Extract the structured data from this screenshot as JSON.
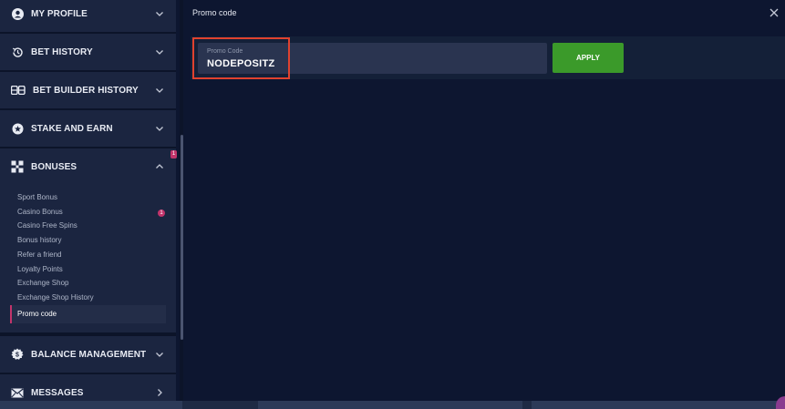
{
  "sidebar": {
    "items": [
      {
        "label": "MY PROFILE",
        "icon": "user-icon"
      },
      {
        "label": "BET HISTORY",
        "icon": "history-icon"
      },
      {
        "label": "BET BUILDER HISTORY",
        "icon": "bet-builder-icon"
      },
      {
        "label": "STAKE AND EARN",
        "icon": "stake-icon"
      },
      {
        "label": "BONUSES",
        "icon": "gift-icon",
        "badge": "1"
      },
      {
        "label": "BALANCE MANAGEMENT",
        "icon": "balance-icon"
      },
      {
        "label": "MESSAGES",
        "icon": "envelope-icon"
      }
    ],
    "bonuses_submenu": [
      {
        "label": "Sport Bonus"
      },
      {
        "label": "Casino Bonus",
        "badge": "1"
      },
      {
        "label": "Casino Free Spins"
      },
      {
        "label": "Bonus history"
      },
      {
        "label": "Refer a friend"
      },
      {
        "label": "Loyalty Points"
      },
      {
        "label": "Exchange Shop"
      },
      {
        "label": "Exchange Shop History"
      },
      {
        "label": "Promo code",
        "active": true
      }
    ]
  },
  "header": {
    "title": "Promo code"
  },
  "promo": {
    "field_label": "Promo Code",
    "value": "NODEPOSITZ",
    "apply_label": "APPLY"
  },
  "colors": {
    "accent_green": "#3b9a2a",
    "badge_pink": "#c2346b",
    "highlight_red": "#e0422f",
    "background": "#0d1630"
  }
}
